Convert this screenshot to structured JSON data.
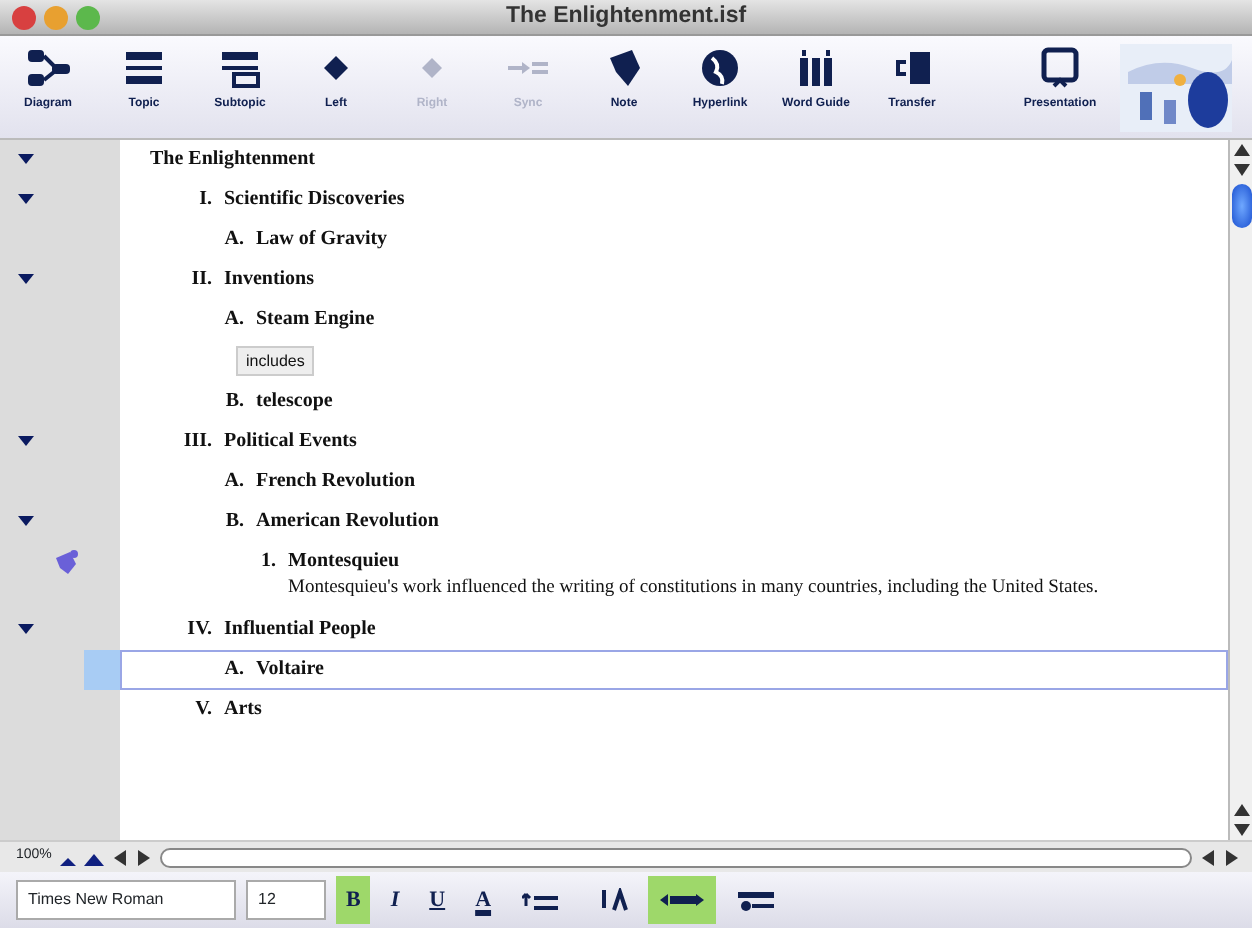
{
  "window": {
    "title": "The Enlightenment.isf"
  },
  "toolbar": [
    {
      "label": "Diagram",
      "disabled": false
    },
    {
      "label": "Topic",
      "disabled": false
    },
    {
      "label": "Subtopic",
      "disabled": false
    },
    {
      "label": "Left",
      "disabled": false
    },
    {
      "label": "Right",
      "disabled": true
    },
    {
      "label": "Sync",
      "disabled": true
    },
    {
      "label": "Note",
      "disabled": false
    },
    {
      "label": "Hyperlink",
      "disabled": false
    },
    {
      "label": "Word Guide",
      "disabled": false
    },
    {
      "label": "Transfer",
      "disabled": false
    },
    {
      "label": "Presentation",
      "disabled": false
    }
  ],
  "outline": [
    {
      "text": "The Enlightenment",
      "expanded": true,
      "selected": false,
      "children": [
        {
          "number": "I.",
          "text": "Scientific Discoveries",
          "expanded": true,
          "selected": false,
          "children": [
            {
              "number": "A.",
              "text": "Law of Gravity",
              "selected": false
            }
          ]
        },
        {
          "number": "II.",
          "text": "Inventions",
          "expanded": true,
          "selected": false,
          "children": [
            {
              "number": "A.",
              "text": "Steam Engine",
              "selected": false,
              "link": "includes"
            },
            {
              "number": "B.",
              "text": "telescope",
              "selected": false
            }
          ]
        },
        {
          "number": "III.",
          "text": "Political Events",
          "expanded": true,
          "selected": false,
          "children": [
            {
              "number": "A.",
              "text": "French Revolution",
              "selected": false
            },
            {
              "number": "B.",
              "text": "American Revolution",
              "expanded": true,
              "selected": false,
              "children": [
                {
                  "number": "1.",
                  "text": "Montesquieu",
                  "selected": false,
                  "note": "Montesquieu's work influenced the writing of constitutions in many countries, including the United States."
                }
              ]
            }
          ]
        },
        {
          "number": "IV.",
          "text": "Influential People",
          "expanded": true,
          "selected": false,
          "children": [
            {
              "number": "A.",
              "text": "Voltaire",
              "selected": true
            }
          ]
        },
        {
          "number": "V.",
          "text": "Arts",
          "selected": false
        }
      ]
    }
  ],
  "zoom": "100%",
  "format_bar": {
    "font": "Times New Roman",
    "size": "12",
    "styles": [
      {
        "label": "B",
        "selected": true
      },
      {
        "label": "I",
        "selected": false
      },
      {
        "label": "U",
        "selected": false
      },
      {
        "label": "A",
        "selected": false
      }
    ],
    "tools": [
      {
        "selected": false
      },
      {
        "selected": false
      },
      {
        "selected": true
      },
      {
        "selected": false
      }
    ]
  }
}
